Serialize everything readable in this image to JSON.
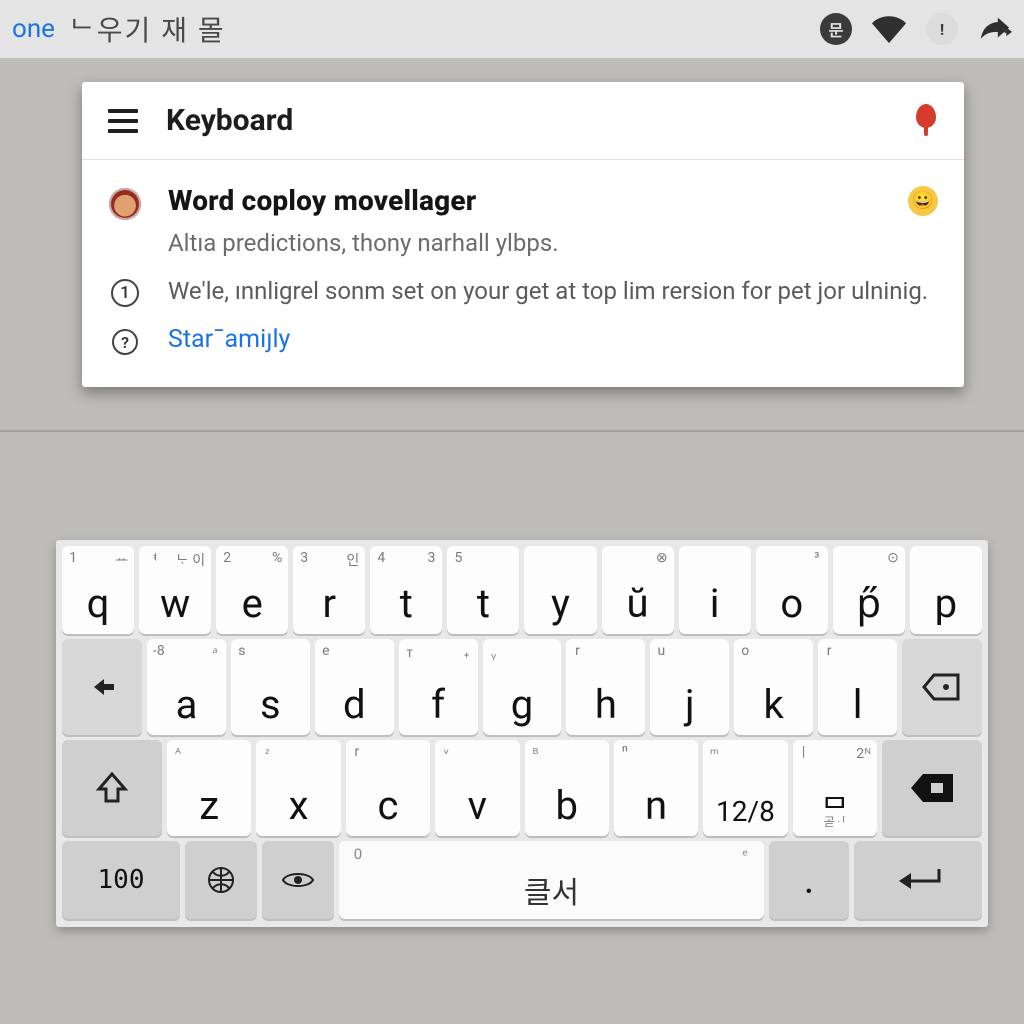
{
  "statusbar": {
    "done": "one",
    "korean_text": "ᄂ우기 재  몰"
  },
  "card": {
    "title": "Keyboard",
    "headline": "Word coploy movellager",
    "subline": "Altıa predictions, thony narhall ylbps.",
    "tip_marker": "1",
    "tip_text": "We'le, ınnligrel sonm set on your get at top lim rersion for pet jor ulninig.",
    "help_marker": "?",
    "link_text": "Starˉamiȷly"
  },
  "keyboard": {
    "row1": [
      {
        "main": "q",
        "supL": "1",
        "supR": "ᅭ"
      },
      {
        "main": "w",
        "supL": "ᅧ",
        "supR": "ᄂᆞ 이"
      },
      {
        "main": "e",
        "supL": "2",
        "supR": "%"
      },
      {
        "main": "r",
        "supL": "3",
        "supR": "인"
      },
      {
        "main": "t",
        "supL": "4",
        "supR": "3"
      },
      {
        "main": "t",
        "supL": "5",
        "supR": ""
      },
      {
        "main": "y",
        "supL": "",
        "supR": ""
      },
      {
        "main": "ŭ",
        "supL": "",
        "supR": "⊗"
      },
      {
        "main": "i",
        "supL": "",
        "supR": ""
      },
      {
        "main": "o",
        "supL": "",
        "supR": "³"
      },
      {
        "main": "p̋",
        "supL": "",
        "supR": "⊙"
      },
      {
        "main": "p",
        "supL": "",
        "supR": ""
      }
    ],
    "row2": [
      {
        "main": "a",
        "supL": "-8",
        "supR": "ᵃ"
      },
      {
        "main": "s",
        "supL": "s",
        "supR": ""
      },
      {
        "main": "d",
        "supL": "e",
        "supR": ""
      },
      {
        "main": "f",
        "supL": "ᴛ",
        "supR": "₊"
      },
      {
        "main": "g",
        "supL": "ᵧ",
        "supR": ""
      },
      {
        "main": "h",
        "supL": "r",
        "supR": ""
      },
      {
        "main": "j",
        "supL": "u",
        "supR": ""
      },
      {
        "main": "k",
        "supL": "o",
        "supR": ""
      },
      {
        "main": "l",
        "supL": "r",
        "supR": ""
      }
    ],
    "row3": [
      {
        "main": "z",
        "supL": "ᴬ",
        "supR": ""
      },
      {
        "main": "x",
        "supL": "ᶻ",
        "supR": ""
      },
      {
        "main": "c",
        "supL": "r",
        "supR": ""
      },
      {
        "main": "v",
        "supL": "ᵛ",
        "supR": ""
      },
      {
        "main": "b",
        "supL": "ᴮ",
        "supR": ""
      },
      {
        "main": "n",
        "supL": "ⁿ",
        "supR": ""
      },
      {
        "main": "12/8",
        "supL": "ᵐ",
        "supR": ""
      },
      {
        "main": "ᄆ",
        "supL": "|",
        "supR": "2ᴺ"
      }
    ],
    "row4": {
      "k100": "100",
      "space_label": "클서",
      "space_supL": "0",
      "space_supR": "ᵉ",
      "dot": "."
    }
  }
}
